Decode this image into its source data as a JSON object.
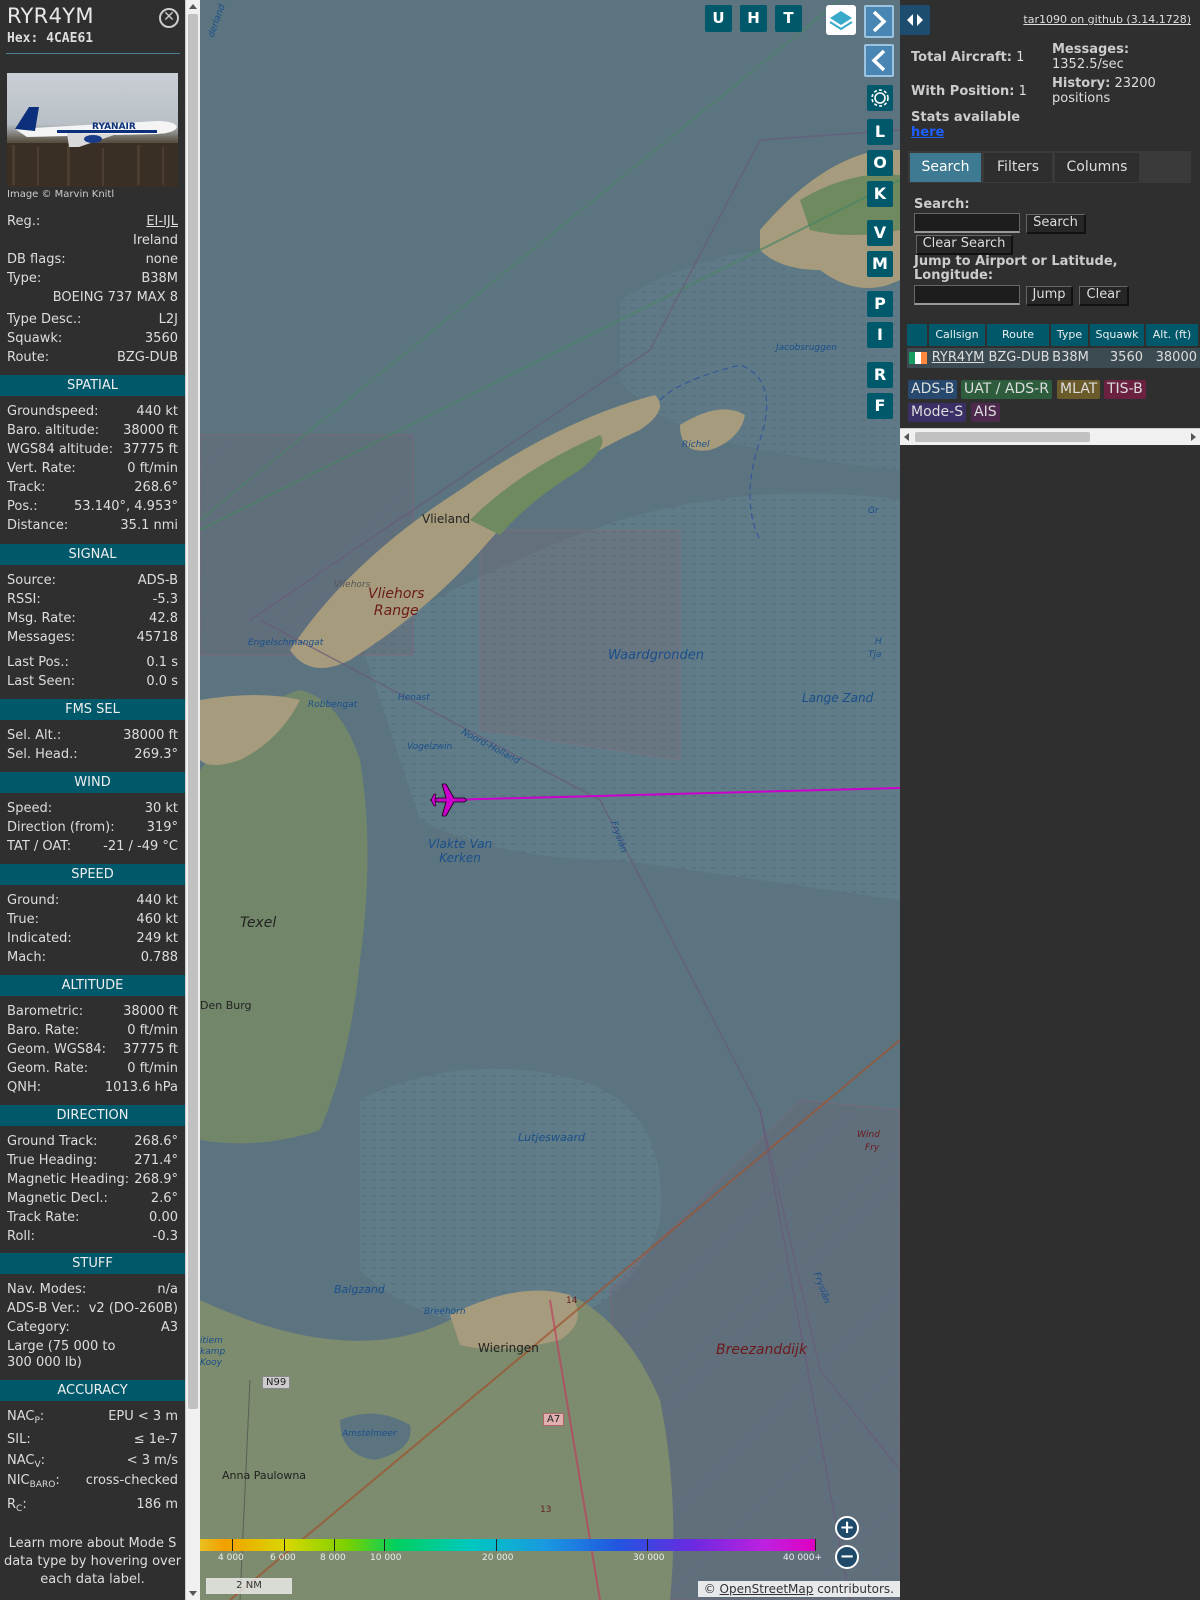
{
  "info": {
    "callsign": "RYR4YM",
    "hex": "Hex: 4CAE61",
    "photo_credit": "Image © Marvin Knitl",
    "photo_livery": "RYANAIR",
    "basic": [
      {
        "k": "Reg.:",
        "v": "EI-IJL"
      },
      {
        "k": "",
        "v": "Ireland"
      },
      {
        "k": "DB flags:",
        "v": "none"
      },
      {
        "k": "Type:",
        "v": "B38M"
      },
      {
        "k": "",
        "v": "BOEING 737 MAX 8"
      },
      {
        "k": "Type Desc.:",
        "v": "L2J"
      },
      {
        "k": "Squawk:",
        "v": "3560"
      },
      {
        "k": "Route:",
        "v": "BZG-DUB"
      }
    ],
    "sections": {
      "spatial": "SPATIAL",
      "signal": "SIGNAL",
      "fms": "FMS SEL",
      "wind": "WIND",
      "speed": "SPEED",
      "altitude": "ALTITUDE",
      "direction": "DIRECTION",
      "stuff": "STUFF",
      "accuracy": "ACCURACY"
    },
    "spatial": [
      {
        "k": "Groundspeed:",
        "v": "440 kt"
      },
      {
        "k": "Baro. altitude:",
        "v": "38000 ft"
      },
      {
        "k": "WGS84 altitude:",
        "v": "37775 ft"
      },
      {
        "k": "Vert. Rate:",
        "v": "0 ft/min"
      },
      {
        "k": "Track:",
        "v": "268.6°"
      },
      {
        "k": "Pos.:",
        "v": "53.140°, 4.953°"
      },
      {
        "k": "Distance:",
        "v": "35.1 nmi"
      }
    ],
    "signal": [
      {
        "k": "Source:",
        "v": "ADS-B"
      },
      {
        "k": "RSSI:",
        "v": "-5.3"
      },
      {
        "k": "Msg. Rate:",
        "v": "42.8"
      },
      {
        "k": "Messages:",
        "v": "45718"
      },
      {
        "k": "Last Pos.:",
        "v": "0.1 s"
      },
      {
        "k": "Last Seen:",
        "v": "0.0 s"
      }
    ],
    "fms": [
      {
        "k": "Sel. Alt.:",
        "v": "38000 ft"
      },
      {
        "k": "Sel. Head.:",
        "v": "269.3°"
      }
    ],
    "wind": [
      {
        "k": "Speed:",
        "v": "30 kt"
      },
      {
        "k": "Direction (from):",
        "v": "319°"
      },
      {
        "k": "TAT / OAT:",
        "v": "-21 / -49 °C"
      }
    ],
    "speed": [
      {
        "k": "Ground:",
        "v": "440 kt"
      },
      {
        "k": "True:",
        "v": "460 kt"
      },
      {
        "k": "Indicated:",
        "v": "249 kt"
      },
      {
        "k": "Mach:",
        "v": "0.788"
      }
    ],
    "altitude": [
      {
        "k": "Barometric:",
        "v": "38000 ft"
      },
      {
        "k": "Baro. Rate:",
        "v": "0 ft/min"
      },
      {
        "k": "Geom. WGS84:",
        "v": "37775 ft"
      },
      {
        "k": "Geom. Rate:",
        "v": "0 ft/min"
      },
      {
        "k": "QNH:",
        "v": "1013.6 hPa"
      }
    ],
    "direction": [
      {
        "k": "Ground Track:",
        "v": "268.6°"
      },
      {
        "k": "True Heading:",
        "v": "271.4°"
      },
      {
        "k": "Magnetic Heading:",
        "v": "268.9°"
      },
      {
        "k": "Magnetic Decl.:",
        "v": "2.6°"
      },
      {
        "k": "Track Rate:",
        "v": "0.00"
      },
      {
        "k": "Roll:",
        "v": "-0.3"
      }
    ],
    "stuff": [
      {
        "k": "Nav. Modes:",
        "v": "n/a"
      },
      {
        "k": "ADS-B Ver.:",
        "v": "v2 (DO-260B)"
      },
      {
        "k": "Category:",
        "v": "A3"
      }
    ],
    "category_desc_1": "Large (75 000 to",
    "category_desc_2": "300 000 lb)",
    "accuracy": {
      "nacp_k": "NAC",
      "nacp_sub": "P",
      "nacp_v": "EPU < 3 m",
      "sil_k": "SIL:",
      "sil_v": "≤ 1e-7",
      "nacv_k": "NAC",
      "nacv_sub": "V",
      "nacv_v": "< 3 m/s",
      "nicbaro_k": "NIC",
      "nicbaro_sub": "BARO",
      "nicbaro_v": "cross-checked",
      "rc_k": "R",
      "rc_sub": "C",
      "rc_v": "186 m"
    },
    "footer": [
      "Learn more about Mode S",
      "data type by hovering over",
      "each data label."
    ]
  },
  "map": {
    "top_buttons": [
      "U",
      "H",
      "T"
    ],
    "side_buttons": [
      "L",
      "O",
      "K",
      "V",
      "M",
      "P",
      "I",
      "R",
      "F"
    ],
    "labels": {
      "vlieland": "Vlieland",
      "vliehors": "Vliehors",
      "vliehors_range_1": "Vliehors",
      "vliehors_range_2": "Range",
      "engelschmangat": "Engelschmangat",
      "waardgronden": "Waardgronden",
      "richel": "Richel",
      "jacobsruggen": "Jacobsruggen",
      "lange_zand": "Lange Zand",
      "robbengat": "Robbengat",
      "henast": "Henast",
      "vogelzwin": "Vogelzwin",
      "noord_holland": "Noord-Holland",
      "vlakte_1": "Vlakte Van",
      "vlakte_2": "Kerken",
      "texel": "Texel",
      "den_burg": "Den Burg",
      "lutjeswaard": "Lutjeswaard",
      "balgzand": "Balgzand",
      "breehorn": "Breehorn",
      "wieringen": "Wieringen",
      "breezanddijk": "Breezanddijk",
      "amstelmeer": "Amstelmeer",
      "anna_paulowna": "Anna Paulowna",
      "n99": "N99",
      "a7": "A7",
      "n14": "14",
      "n13": "13",
      "fryslan": "Fryslân",
      "gr": "Gr",
      "wind_fry": "Wind",
      "fry_2": "Fry",
      "tjalk": "Tja",
      "h": "H",
      "jelderland": "derland",
      "itiem": "itiem",
      "kamp": "kamp",
      "kooy": "Kooy"
    },
    "scale": "2 NM",
    "attribution_prefix": "© ",
    "attribution_link": "OpenStreetMap",
    "attribution_suffix": " contributors.",
    "altitude_legend": [
      "4 000",
      "6 000",
      "8 000",
      "10 000",
      "20 000",
      "30 000",
      "40 000+"
    ],
    "track_color": "#cc00cc",
    "aircraft_color": "#cc00cc"
  },
  "sidebar": {
    "github": "tar1090 on github (3.14.1728)",
    "total_aircraft_label": "Total Aircraft:",
    "total_aircraft": "1",
    "with_position_label": "With Position:",
    "with_position": "1",
    "messages_label": "Messages:",
    "messages_value": "1352.5/sec",
    "history_label": "History:",
    "history_value": "23200",
    "history_unit": "positions",
    "stats_label": "Stats available",
    "stats_link": "here",
    "tabs": [
      "Search",
      "Filters",
      "Columns"
    ],
    "search_label": "Search:",
    "search_button": "Search",
    "clear_search_button": "Clear Search",
    "jump_label_1": "Jump to Airport or Latitude,",
    "jump_label_2": "Longitude:",
    "jump_button": "Jump",
    "clear_button": "Clear",
    "table_headers": [
      "Callsign",
      "Route",
      "Type",
      "Squawk",
      "Alt. (ft)"
    ],
    "table_rows": [
      {
        "callsign": "RYR4YM",
        "route": "BZG-DUB",
        "type": "B38M",
        "squawk": "3560",
        "alt": "38000"
      }
    ],
    "source_legend": [
      {
        "label": "ADS-B",
        "color": "#27496d",
        "text": "#ddd"
      },
      {
        "label": "UAT / ADS-R",
        "color": "#2d5d3d",
        "text": "#ddd"
      },
      {
        "label": "MLAT",
        "color": "#6b5a2a",
        "text": "#ddd"
      },
      {
        "label": "TIS-B",
        "color": "#6b2240",
        "text": "#ddd"
      },
      {
        "label": "Mode-S",
        "color": "#3b2f66",
        "text": "#ddd"
      },
      {
        "label": "AIS",
        "color": "#4d2a4d",
        "text": "#ddd"
      }
    ]
  }
}
